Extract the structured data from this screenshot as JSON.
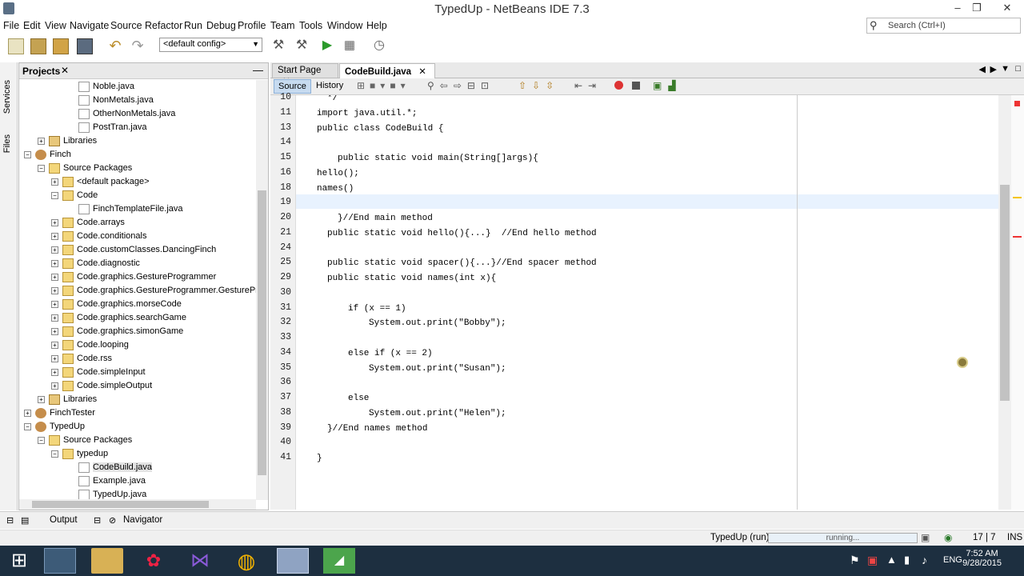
{
  "window": {
    "title": "TypedUp - NetBeans IDE 7.3",
    "minimize": "‒",
    "restore": "❐",
    "close": "✕"
  },
  "menu": [
    "File",
    "Edit",
    "View",
    "Navigate",
    "Source",
    "Refactor",
    "Run",
    "Debug",
    "Profile",
    "Team",
    "Tools",
    "Window",
    "Help"
  ],
  "search": {
    "placeholder": "Search (Ctrl+I)"
  },
  "config": {
    "selected": "<default config>"
  },
  "side_strip": [
    "Services",
    "Files"
  ],
  "projects_panel": {
    "title": "Projects",
    "items": [
      {
        "label": "Noble.java",
        "type": "java",
        "level": 4
      },
      {
        "label": "NonMetals.java",
        "type": "java",
        "level": 4
      },
      {
        "label": "OtherNonMetals.java",
        "type": "java",
        "level": 4
      },
      {
        "label": "PostTran.java",
        "type": "java",
        "level": 4
      },
      {
        "label": "Libraries",
        "type": "lib",
        "level": 1,
        "exp": "+"
      },
      {
        "label": "Finch",
        "type": "proj",
        "level": 0,
        "exp": "−"
      },
      {
        "label": "Source Packages",
        "type": "pkg",
        "level": 1,
        "exp": "−"
      },
      {
        "label": "<default package>",
        "type": "pkg",
        "level": 2,
        "exp": "+"
      },
      {
        "label": "Code",
        "type": "pkg",
        "level": 2,
        "exp": "−"
      },
      {
        "label": "FinchTemplateFile.java",
        "type": "java",
        "level": 4
      },
      {
        "label": "Code.arrays",
        "type": "pkg",
        "level": 2,
        "exp": "+"
      },
      {
        "label": "Code.conditionals",
        "type": "pkg",
        "level": 2,
        "exp": "+"
      },
      {
        "label": "Code.customClasses.DancingFinch",
        "type": "pkg",
        "level": 2,
        "exp": "+"
      },
      {
        "label": "Code.diagnostic",
        "type": "pkg",
        "level": 2,
        "exp": "+"
      },
      {
        "label": "Code.graphics.GestureProgrammer",
        "type": "pkg",
        "level": 2,
        "exp": "+"
      },
      {
        "label": "Code.graphics.GestureProgrammer.GestureProg",
        "type": "pkg",
        "level": 2,
        "exp": "+"
      },
      {
        "label": "Code.graphics.morseCode",
        "type": "pkg",
        "level": 2,
        "exp": "+"
      },
      {
        "label": "Code.graphics.searchGame",
        "type": "pkg",
        "level": 2,
        "exp": "+"
      },
      {
        "label": "Code.graphics.simonGame",
        "type": "pkg",
        "level": 2,
        "exp": "+"
      },
      {
        "label": "Code.looping",
        "type": "pkg",
        "level": 2,
        "exp": "+"
      },
      {
        "label": "Code.rss",
        "type": "pkg",
        "level": 2,
        "exp": "+"
      },
      {
        "label": "Code.simpleInput",
        "type": "pkg",
        "level": 2,
        "exp": "+"
      },
      {
        "label": "Code.simpleOutput",
        "type": "pkg",
        "level": 2,
        "exp": "+"
      },
      {
        "label": "Libraries",
        "type": "lib",
        "level": 1,
        "exp": "+"
      },
      {
        "label": "FinchTester",
        "type": "proj",
        "level": 0,
        "exp": "+"
      },
      {
        "label": "TypedUp",
        "type": "proj",
        "level": 0,
        "exp": "−"
      },
      {
        "label": "Source Packages",
        "type": "pkg",
        "level": 1,
        "exp": "−"
      },
      {
        "label": "typedup",
        "type": "pkg",
        "level": 2,
        "exp": "−"
      },
      {
        "label": "CodeBuild.java",
        "type": "java",
        "level": 4,
        "selected": true
      },
      {
        "label": "Example.java",
        "type": "java",
        "level": 4
      },
      {
        "label": "TypedUp.java",
        "type": "java",
        "level": 4
      }
    ]
  },
  "editor": {
    "tabs": [
      {
        "label": "Start Page",
        "active": false
      },
      {
        "label": "CodeBuild.java",
        "active": true
      }
    ],
    "source_label": "Source",
    "history_label": "History",
    "lines": [
      {
        "n": "10",
        "text": "*/",
        "indent": 3
      },
      {
        "n": "11",
        "text": "import java.util.*;",
        "indent": 2,
        "fold": "−"
      },
      {
        "n": "13",
        "text": "public class CodeBuild {",
        "indent": 2
      },
      {
        "n": "14",
        "text": "",
        "indent": 0
      },
      {
        "n": "15",
        "text": "public static void main(String[]args){",
        "indent": 4,
        "fold": "−"
      },
      {
        "n": "16",
        "text": "hello();",
        "indent": 2
      },
      {
        "n": "18",
        "text": "names()",
        "indent": 2
      },
      {
        "n": "19",
        "text": "",
        "indent": 0
      },
      {
        "n": "20",
        "text": "}//End main method",
        "indent": 4
      },
      {
        "n": "21",
        "text": "public static void hello(){...}  //End hello method",
        "indent": 3,
        "fold": "+"
      },
      {
        "n": "24",
        "text": "",
        "indent": 0
      },
      {
        "n": "25",
        "text": "public static void spacer(){...}//End spacer method",
        "indent": 3,
        "fold": "+"
      },
      {
        "n": "29",
        "text": "public static void names(int x){",
        "indent": 3,
        "fold": "−"
      },
      {
        "n": "30",
        "text": "",
        "indent": 0
      },
      {
        "n": "31",
        "text": "if (x == 1)",
        "indent": 5
      },
      {
        "n": "32",
        "text": "System.out.print(\"Bobby\");",
        "indent": 7
      },
      {
        "n": "33",
        "text": "",
        "indent": 0
      },
      {
        "n": "34",
        "text": "else if (x == 2)",
        "indent": 5
      },
      {
        "n": "35",
        "text": "System.out.print(\"Susan\");",
        "indent": 7
      },
      {
        "n": "36",
        "text": "",
        "indent": 0
      },
      {
        "n": "37",
        "text": "else",
        "indent": 5
      },
      {
        "n": "38",
        "text": "System.out.print(\"Helen\");",
        "indent": 7
      },
      {
        "n": "39",
        "text": "}//End names method",
        "indent": 3
      },
      {
        "n": "40",
        "text": "",
        "indent": 0
      },
      {
        "n": "41",
        "text": "}",
        "indent": 2
      }
    ]
  },
  "bottom_tabs": [
    "Output",
    "Navigator"
  ],
  "status": {
    "run_label": "TypedUp (run)",
    "progress_text": "running...",
    "position": "17 | 7",
    "insert_mode": "INS"
  },
  "taskbar": {
    "time": "7:52 AM",
    "date": "9/28/2015",
    "lang": "ENG"
  }
}
